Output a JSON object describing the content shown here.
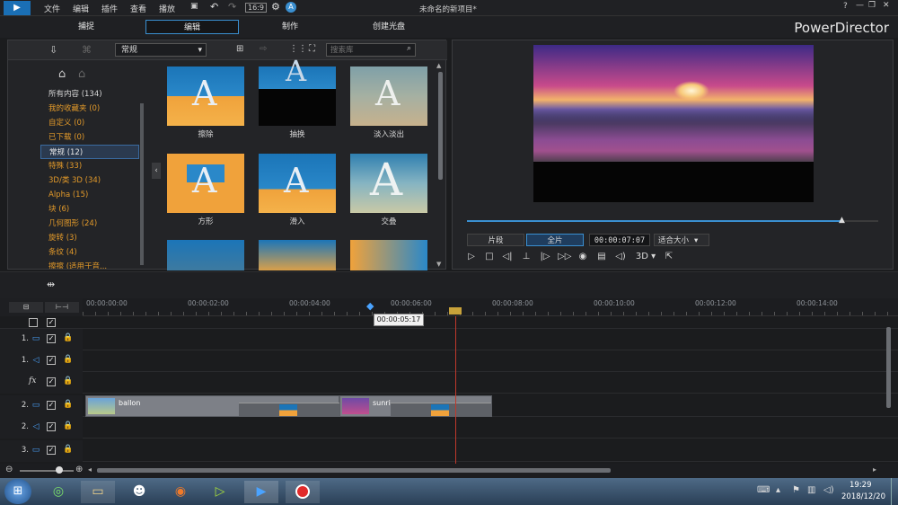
{
  "menu": [
    "文件",
    "编辑",
    "插件",
    "查看",
    "播放"
  ],
  "window_title": "未命名的新项目*",
  "tabs": [
    {
      "label": "捕捉"
    },
    {
      "label": "编辑"
    },
    {
      "label": "制作"
    },
    {
      "label": "创建光盘"
    }
  ],
  "brand": "PowerDirector",
  "library": {
    "dropdown_value": "常规",
    "search_placeholder": "搜索库",
    "categories": [
      "所有内容 (134)",
      "我的收藏夹 (0)",
      "自定义 (0)",
      "已下载 (0)",
      "常规 (12)",
      "特殊 (33)",
      "3D/类 3D (34)",
      "Alpha (15)",
      "块 (6)",
      "几何图形 (24)",
      "旋转 (3)",
      "条纹 (4)",
      "擦擦 (适用于音..."
    ],
    "items": [
      "擦除",
      "抽换",
      "淡入淡出",
      "方形",
      "滑入",
      "交叠"
    ]
  },
  "preview": {
    "mode_clip": "片段",
    "mode_full": "全片",
    "timecode": "00:00:07:07",
    "fit": "适合大小",
    "mode_3d": "3D"
  },
  "timeline": {
    "ruler": [
      "00:00:00:00",
      "00:00:02:00",
      "00:00:04:00",
      "00:00:06:00",
      "00:00:08:00",
      "00:00:10:00",
      "00:00:12:00",
      "00:00:14:00"
    ],
    "cursor_time": "00:00:05:17",
    "tracks": [
      {
        "num": "1.",
        "type": "video"
      },
      {
        "num": "1.",
        "type": "audio"
      },
      {
        "num": "",
        "type": "fx",
        "label": "fx"
      },
      {
        "num": "2.",
        "type": "video"
      },
      {
        "num": "2.",
        "type": "audio"
      },
      {
        "num": "3.",
        "type": "video"
      }
    ],
    "clips": [
      {
        "name": "ballon"
      },
      {
        "name": "sunri"
      }
    ]
  },
  "taskbar": {
    "time": "19:29",
    "date": "2018/12/20"
  },
  "colors": {
    "accent": "#3a8fd0",
    "category_text": "#e39a2a",
    "playhead": "#c0392b"
  }
}
